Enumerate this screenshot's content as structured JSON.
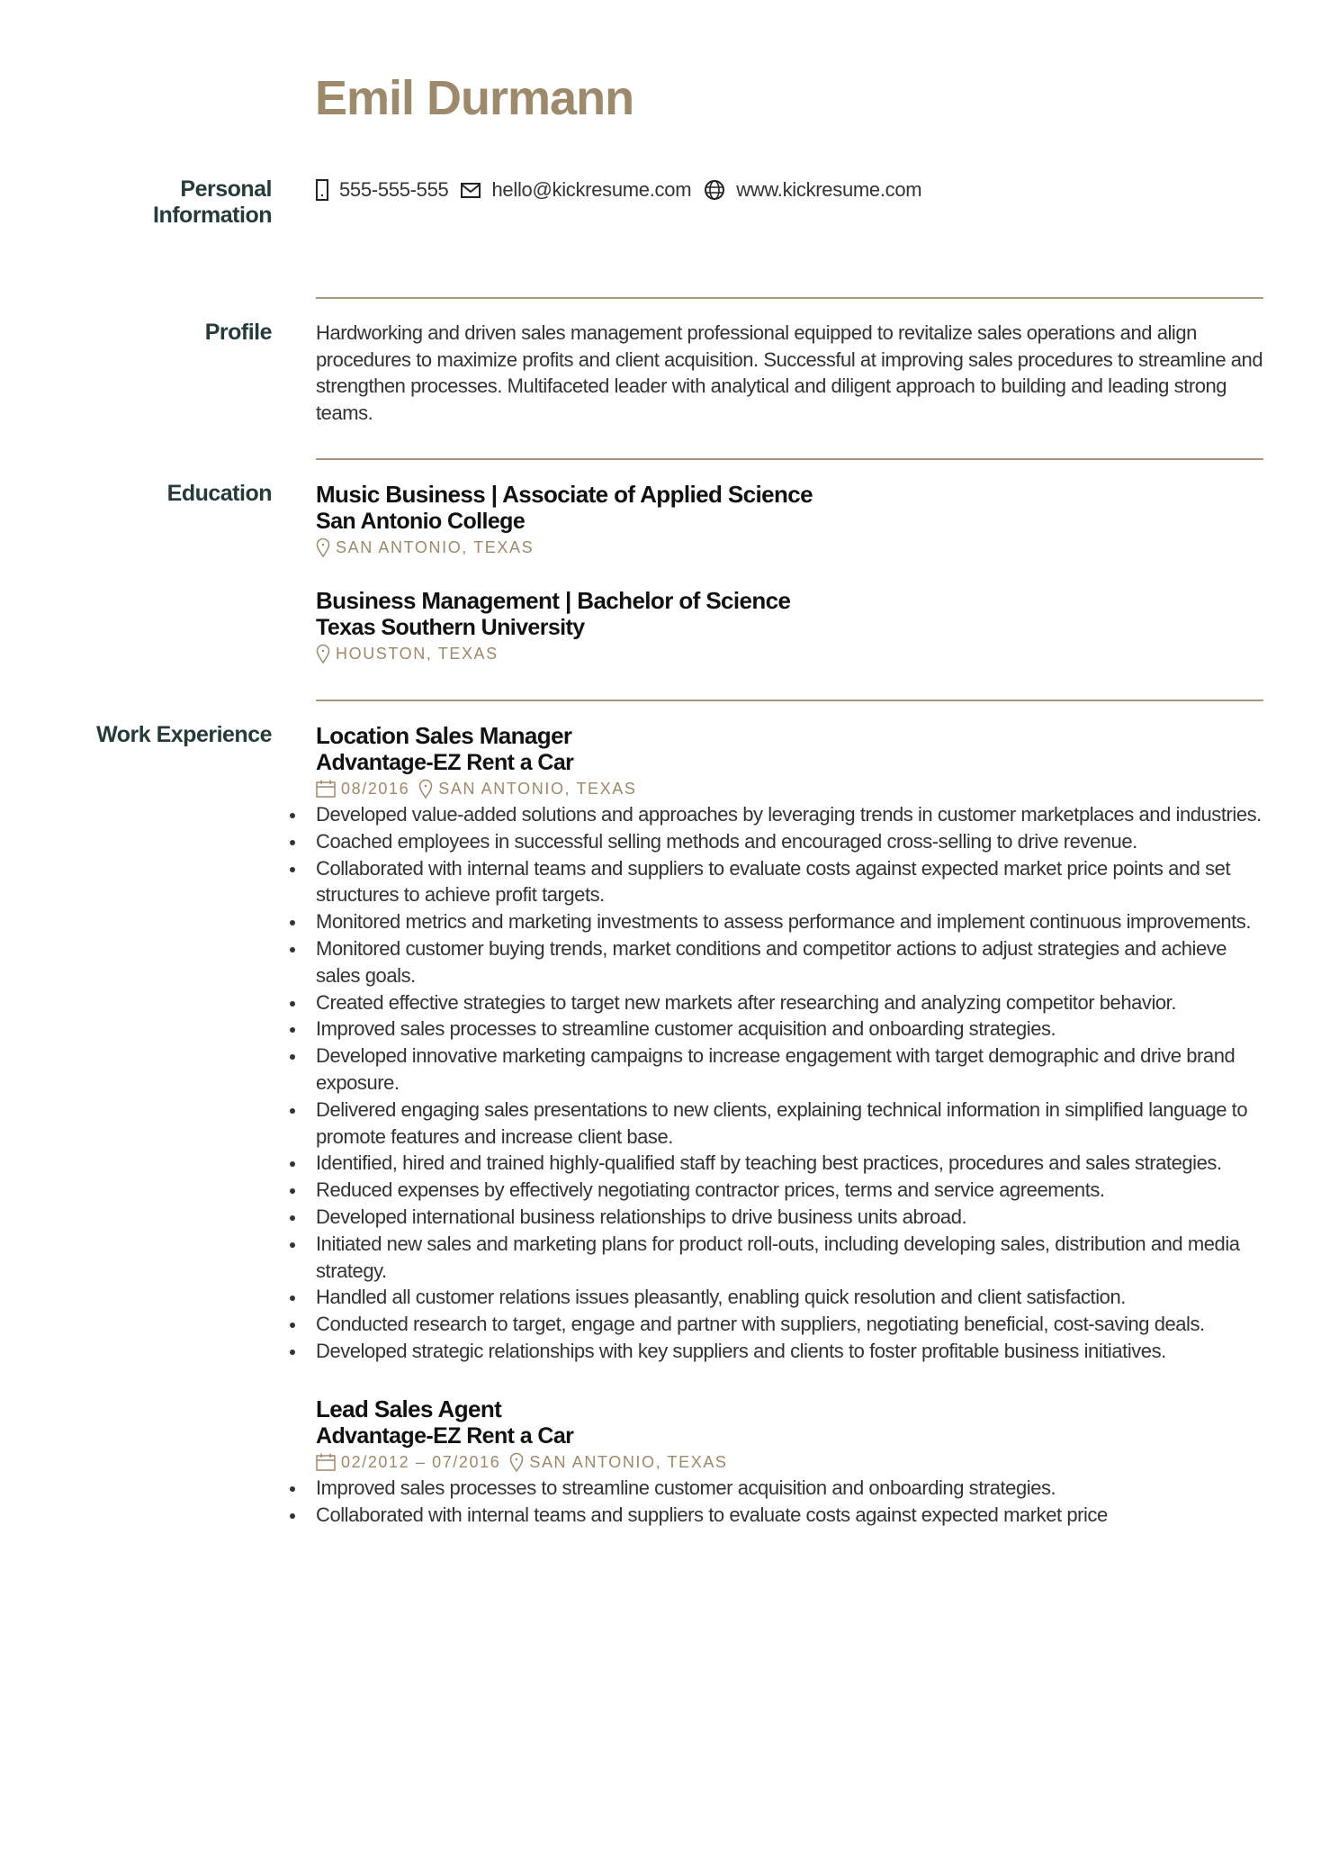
{
  "name": "Emil Durmann",
  "colors": {
    "accent": "#9d896c",
    "label": "#263a3a",
    "text": "#333333"
  },
  "personal_information": {
    "label": "Personal Information",
    "label_line1": "Personal",
    "label_line2": "Information",
    "phone": {
      "icon": "phone-icon",
      "value": "555-555-555"
    },
    "email": {
      "icon": "envelope-icon",
      "value": "hello@kickresume.com"
    },
    "website": {
      "icon": "globe-icon",
      "value": "www.kickresume.com"
    }
  },
  "profile": {
    "label": "Profile",
    "text": "Hardworking and driven sales management professional equipped to revitalize sales operations and align procedures to maximize profits and client acquisition. Successful at improving sales procedures to streamline and strengthen processes. Multifaceted leader with analytical and diligent approach to building and leading strong teams."
  },
  "education": {
    "label": "Education",
    "entries": [
      {
        "title": "Music Business | Associate of Applied Science",
        "school": "San Antonio College",
        "location": "San Antonio, Texas",
        "location_icon": "map-pin-icon"
      },
      {
        "title": "Business Management | Bachelor of Science",
        "school": "Texas Southern University",
        "location": "Houston, Texas",
        "location_icon": "map-pin-icon"
      }
    ]
  },
  "work_experience": {
    "label": "Work Experience",
    "entries": [
      {
        "title": "Location Sales Manager",
        "company": "Advantage-EZ Rent a Car",
        "date": "08/2016",
        "location": "San Antonio, Texas",
        "bullets": [
          "Developed value-added solutions and approaches by leveraging trends in customer marketplaces and industries.",
          "Coached employees in successful selling methods and encouraged cross-selling to drive revenue.",
          "Collaborated with internal teams and suppliers to evaluate costs against expected market price points and set structures to achieve profit targets.",
          "Monitored metrics and marketing investments to assess performance and implement continuous improvements.",
          "Monitored customer buying trends, market conditions and competitor actions to adjust strategies and achieve sales goals.",
          "Created effective strategies to target new markets after researching and analyzing competitor behavior.",
          "Improved sales processes to streamline customer acquisition and onboarding strategies.",
          "Developed innovative marketing campaigns to increase engagement with target demographic and drive brand exposure.",
          "Delivered engaging sales presentations to new clients, explaining technical information in simplified language to promote features and increase client base.",
          "Identified, hired and trained highly-qualified staff by teaching best practices, procedures and sales strategies.",
          "Reduced expenses by effectively negotiating contractor prices, terms and service agreements.",
          "Developed international business relationships to drive business units abroad.",
          "Initiated new sales and marketing plans for product roll-outs, including developing sales, distribution and media strategy.",
          "Handled all customer relations issues pleasantly, enabling quick resolution and client satisfaction.",
          "Conducted research to target, engage and partner with suppliers, negotiating beneficial, cost-saving deals.",
          "Developed strategic relationships with key suppliers and clients to foster profitable business initiatives."
        ]
      },
      {
        "title": "Lead Sales Agent",
        "company": "Advantage-EZ Rent a Car",
        "date": "02/2012 – 07/2016",
        "location": "San Antonio, Texas",
        "bullets": [
          "Improved sales processes to streamline customer acquisition and onboarding strategies.",
          "Collaborated with internal teams and suppliers to evaluate costs against expected market price"
        ]
      }
    ]
  }
}
